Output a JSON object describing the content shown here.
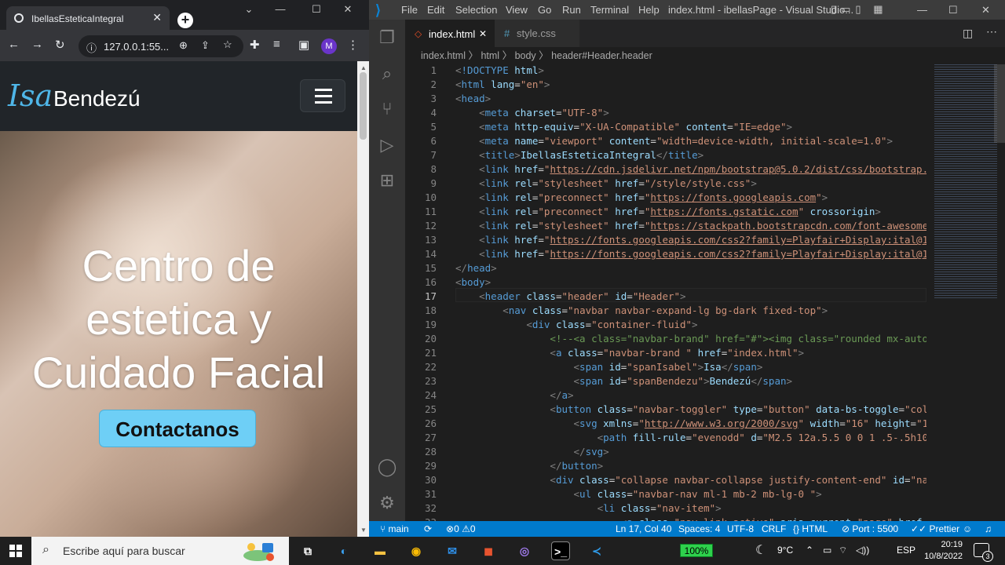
{
  "browser": {
    "tab_title": "IbellasEsteticaIntegral",
    "tab_close": "✕",
    "new_tab": "+",
    "address": "127.0.0.1:55...",
    "profile_initial": "M",
    "window_min": "⌄",
    "window_restore": "—",
    "window_max": "☐",
    "window_close": "✕"
  },
  "site": {
    "brand_first": "Isa",
    "brand_last": "Bendezú",
    "hero_title_line1": "Centro de",
    "hero_title_line2": "estetica y",
    "hero_title_line3": "Cuidado Facial",
    "cta_label": "Contactanos"
  },
  "vscode": {
    "menu": [
      "File",
      "Edit",
      "Selection",
      "View",
      "Go",
      "Run",
      "Terminal",
      "Help"
    ],
    "window_title": "index.html - ibellasPage - Visual Studio...",
    "tabs": [
      {
        "label": "index.html",
        "close": "✕"
      },
      {
        "label": "style.css"
      }
    ],
    "breadcrumb": [
      "index.html",
      "html",
      "body",
      "header#Header.header"
    ],
    "current_line": 17,
    "status": {
      "branch": "main",
      "errors": "0",
      "warnings": "0",
      "cursor": "Ln 17, Col 40",
      "spaces": "Spaces: 4",
      "encoding": "UTF-8",
      "eol": "CRLF",
      "language": "HTML",
      "port": "Port : 5500",
      "prettier": "Prettier"
    }
  },
  "code_lines": [
    "<!DOCTYPE html>",
    "<html lang=\"en\">",
    "<head>",
    "    <meta charset=\"UTF-8\">",
    "    <meta http-equiv=\"X-UA-Compatible\" content=\"IE=edge\">",
    "    <meta name=\"viewport\" content=\"width=device-width, initial-scale=1.0\">",
    "    <title>IbellasEsteticaIntegral</title>",
    "    <link href=\"https://cdn.jsdelivr.net/npm/bootstrap@5.0.2/dist/css/bootstrap.min",
    "    <link rel=\"stylesheet\" href=\"/style/style.css\">",
    "    <link rel=\"preconnect\" href=\"https://fonts.googleapis.com\">",
    "    <link rel=\"preconnect\" href=\"https://fonts.gstatic.com\" crossorigin>",
    "    <link rel=\"stylesheet\" href=\"https://stackpath.bootstrapcdn.com/font-awesome/4.",
    "    <link href=\"https://fonts.googleapis.com/css2?family=Playfair+Display:ital@1&fa",
    "    <link href=\"https://fonts.googleapis.com/css2?family=Playfair+Display:ital@1&fa",
    "</head>",
    "<body>",
    "    <header class=\"header\" id=\"Header\">",
    "        <nav class=\"navbar navbar-expand-lg bg-dark fixed-top\">",
    "            <div class=\"container-fluid\">",
    "                <!--<a class=\"navbar-brand\" href=\"#\"><img class=\"rounded mx-auto d-bl",
    "                <a class=\"navbar-brand \" href=\"index.html\">",
    "                    <span id=\"spanIsabel\">Isa</span>",
    "                    <span id=\"spanBendezu\">Bendezú</span>",
    "                </a>",
    "                <button class=\"navbar-toggler\" type=\"button\" data-bs-toggle=\"collapse",
    "                    <svg xmlns=\"http://www.w3.org/2000/svg\" width=\"16\" height=\"16\" fill",
    "                        <path fill-rule=\"evenodd\" d=\"M2.5 12a.5.5 0 0 1 .5-.5h10a.5.5 0",
    "                    </svg>",
    "                </button>",
    "                <div class=\"collapse navbar-collapse justify-content-end\" id=\"navbarT",
    "                    <ul class=\"navbar-nav ml-1 mb-2 mb-lg-0 \">",
    "                        <li class=\"nav-item\">",
    "                            <a class=\"nav-link active\" aria-current=\"page\" href=\"#He"
  ],
  "taskbar": {
    "search_placeholder": "Escribe aquí para buscar",
    "battery": "100%",
    "temperature": "9°C",
    "language": "ESP",
    "time": "20:19",
    "date": "10/8/2022",
    "notifications": "3"
  }
}
